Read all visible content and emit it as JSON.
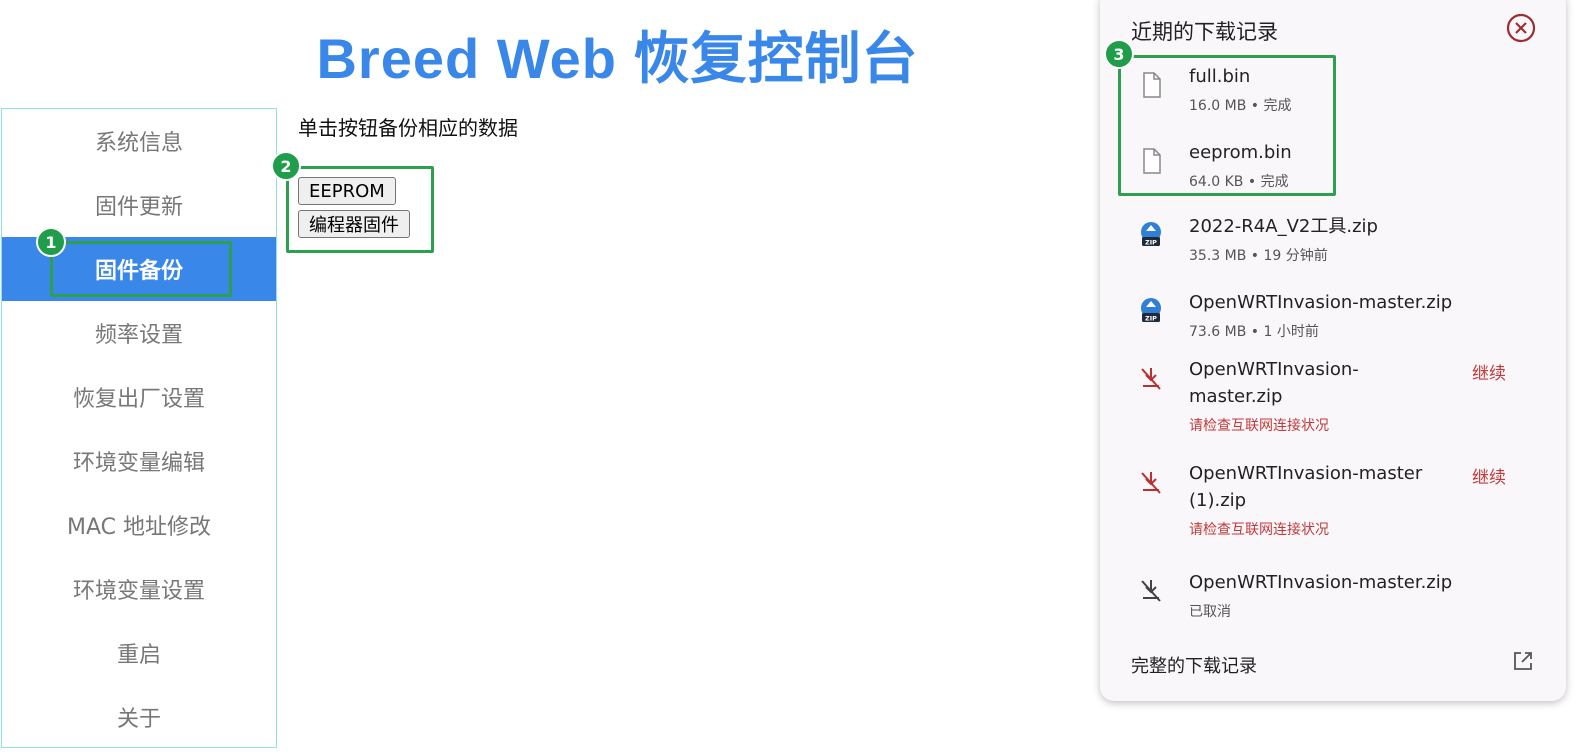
{
  "page": {
    "title": "Breed Web 恢复控制台"
  },
  "sidebar": {
    "items": [
      {
        "label": "系统信息",
        "active": false
      },
      {
        "label": "固件更新",
        "active": false
      },
      {
        "label": "固件备份",
        "active": true
      },
      {
        "label": "频率设置",
        "active": false
      },
      {
        "label": "恢复出厂设置",
        "active": false
      },
      {
        "label": "环境变量编辑",
        "active": false
      },
      {
        "label": "MAC 地址修改",
        "active": false
      },
      {
        "label": "环境变量设置",
        "active": false
      },
      {
        "label": "重启",
        "active": false
      },
      {
        "label": "关于",
        "active": false
      }
    ]
  },
  "main": {
    "instruction": "单击按钮备份相应的数据",
    "buttons": {
      "eeprom": "EEPROM",
      "programmer_firmware": "编程器固件"
    }
  },
  "annotations": {
    "badge1": "1",
    "badge2": "2",
    "badge3": "3",
    "highlight_color": "#2e9e4f"
  },
  "downloads": {
    "title": "近期的下载记录",
    "items": [
      {
        "name": "full.bin",
        "meta": "16.0 MB • 完成",
        "icon": "file-icon",
        "action": ""
      },
      {
        "name": "eeprom.bin",
        "meta": "64.0 KB • 完成",
        "icon": "file-icon",
        "action": ""
      },
      {
        "name": "2022-R4A_V2工具.zip",
        "meta": "35.3 MB • 19 分钟前",
        "icon": "zip-icon",
        "action": ""
      },
      {
        "name": "OpenWRTInvasion-master.zip",
        "meta": "73.6 MB • 1 小时前",
        "icon": "zip-icon",
        "action": ""
      },
      {
        "name_line1": "OpenWRTInvasion-",
        "name_line2": "master.zip",
        "meta": "请检查互联网连接状况",
        "icon": "download-failed-icon",
        "action": "继续"
      },
      {
        "name_line1": "OpenWRTInvasion-master",
        "name_line2": "(1).zip",
        "meta": "请检查互联网连接状况",
        "icon": "download-failed-icon",
        "action": "继续"
      },
      {
        "name": "OpenWRTInvasion-master.zip",
        "meta": "已取消",
        "icon": "download-cancelled-icon",
        "action": ""
      }
    ],
    "footer": "完整的下载记录"
  },
  "colors": {
    "accent": "#3a87ea",
    "error": "#c23a3a",
    "badge": "#1f9d4a"
  }
}
